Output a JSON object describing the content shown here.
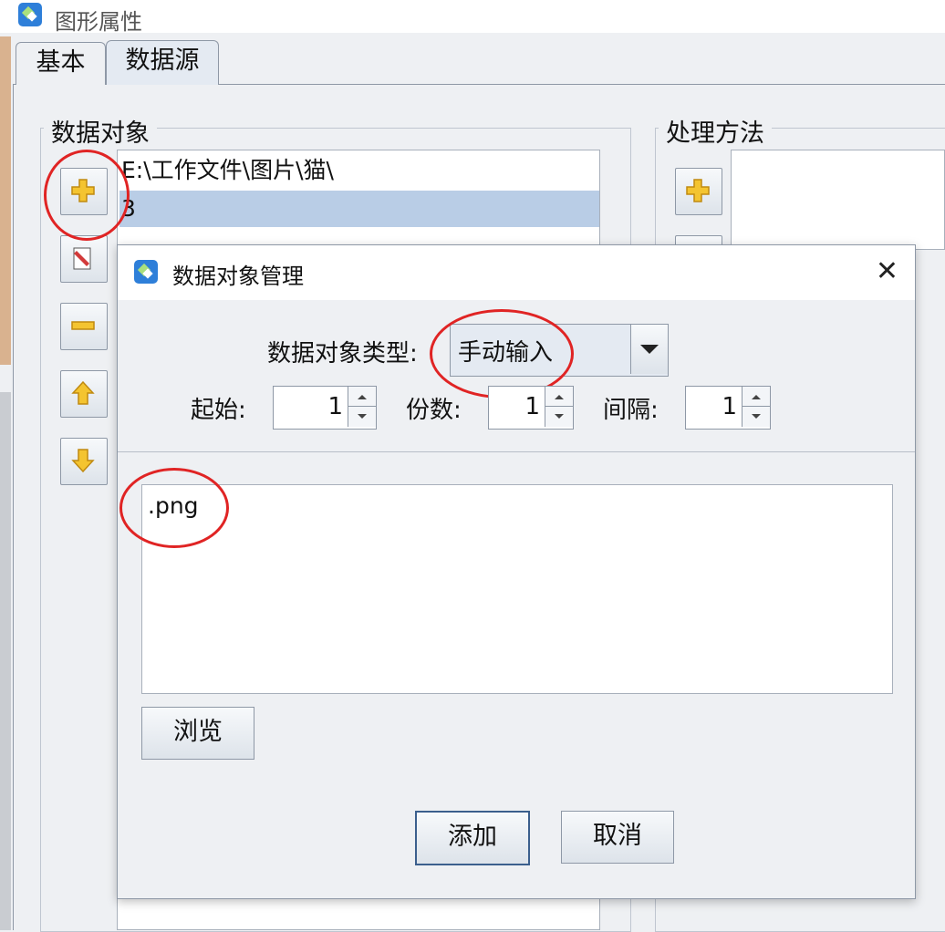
{
  "window": {
    "title": "图形属性"
  },
  "tabs": [
    {
      "label": "基本"
    },
    {
      "label": "数据源"
    }
  ],
  "data_group": {
    "legend": "数据对象",
    "items": [
      {
        "label": "E:\\工作文件\\图片\\猫\\",
        "selected": false
      },
      {
        "label": "3",
        "selected": true
      }
    ],
    "buttons": [
      "add-icon",
      "edit-icon",
      "remove-icon",
      "move-up-icon",
      "move-down-icon"
    ]
  },
  "proc_group": {
    "legend": "处理方法"
  },
  "dialog": {
    "title": "数据对象管理",
    "close_label": "✕",
    "type_label": "数据对象类型:",
    "type_value": "手动输入",
    "start_label": "起始:",
    "start_value": "1",
    "count_label": "份数:",
    "count_value": "1",
    "interval_label": "间隔:",
    "interval_value": "1",
    "content": ".png",
    "browse_label": "浏览",
    "add_label": "添加",
    "cancel_label": "取消"
  },
  "colors": {
    "highlight": "#e02424",
    "selection": "#b9cde6",
    "icon_yellow": "#f4c430"
  }
}
